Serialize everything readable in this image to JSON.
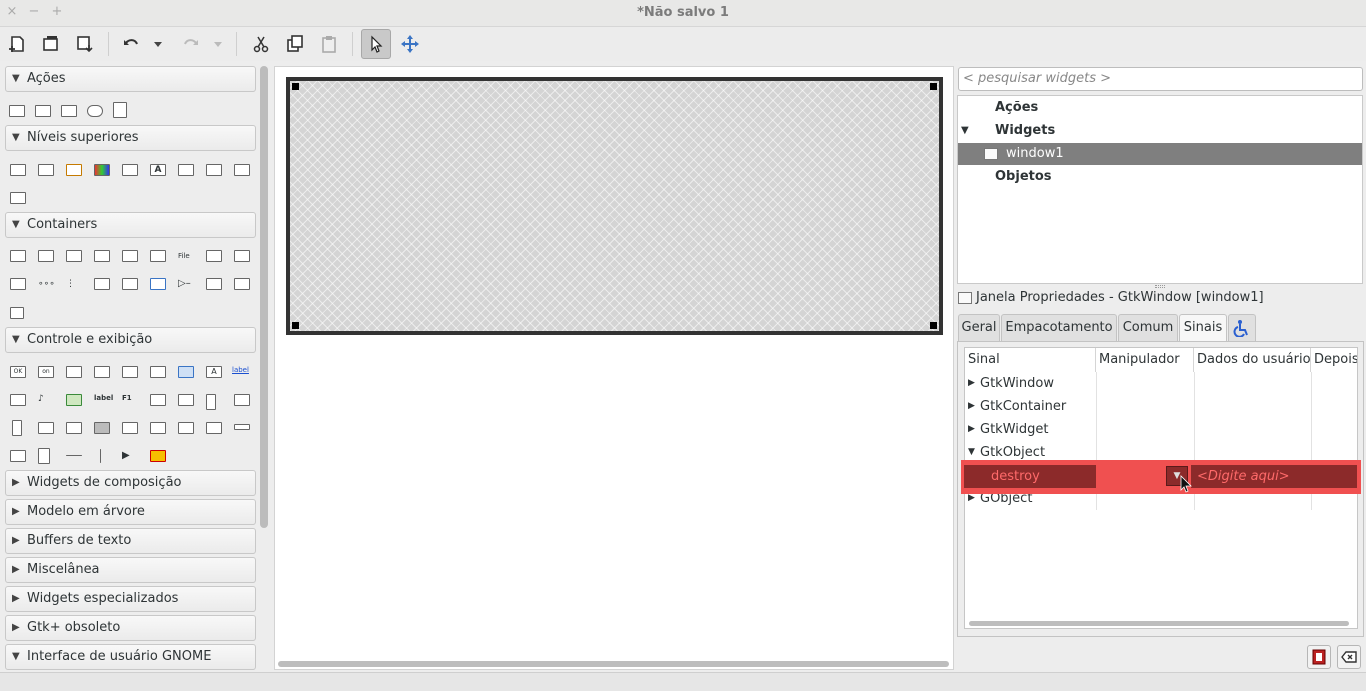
{
  "window": {
    "title": "*Não salvo 1",
    "close": "×",
    "minimize": "−",
    "maximize": "+"
  },
  "palette": {
    "categories": [
      {
        "label": "Ações",
        "expanded": true
      },
      {
        "label": "Níveis superiores",
        "expanded": true
      },
      {
        "label": "Containers",
        "expanded": true
      },
      {
        "label": "Controle e exibição",
        "expanded": true
      },
      {
        "label": "Widgets de composição",
        "expanded": false
      },
      {
        "label": "Modelo em árvore",
        "expanded": false
      },
      {
        "label": "Buffers de texto",
        "expanded": false
      },
      {
        "label": "Miscelânea",
        "expanded": false
      },
      {
        "label": "Widgets especializados",
        "expanded": false
      },
      {
        "label": "Gtk+ obsoleto",
        "expanded": false
      },
      {
        "label": "Interface de usuário GNOME",
        "expanded": true
      }
    ],
    "icon_texts": {
      "file": "File",
      "label": "label",
      "on": "on",
      "ok": "OK",
      "f1": "F1"
    }
  },
  "inspector": {
    "search_placeholder": "< pesquisar widgets >",
    "tree": [
      {
        "label": "Ações",
        "bold": true
      },
      {
        "label": "Widgets",
        "bold": true,
        "expanded": true
      },
      {
        "label": "window1",
        "selected": true
      },
      {
        "label": "Objetos",
        "bold": true
      }
    ]
  },
  "properties": {
    "title": "Janela Propriedades - GtkWindow [window1]",
    "tabs": [
      "Geral",
      "Empacotamento",
      "Comum",
      "Sinais"
    ],
    "active_tab": "Sinais",
    "columns": [
      "Sinal",
      "Manipulador",
      "Dados do usuário",
      "Depois"
    ],
    "signals": [
      {
        "label": "GtkWindow",
        "expanded": false
      },
      {
        "label": "GtkContainer",
        "expanded": false
      },
      {
        "label": "GtkWidget",
        "expanded": false
      },
      {
        "label": "GtkObject",
        "expanded": true
      },
      {
        "label": "GObject",
        "expanded": false
      }
    ],
    "selected_signal": {
      "name": "destroy",
      "handler": "",
      "user_data_placeholder": "<Digite aqui>"
    }
  },
  "colors": {
    "selection": "#7f7f7f",
    "signal_highlight": "#f05050",
    "signal_row": "#8c2a2a"
  }
}
